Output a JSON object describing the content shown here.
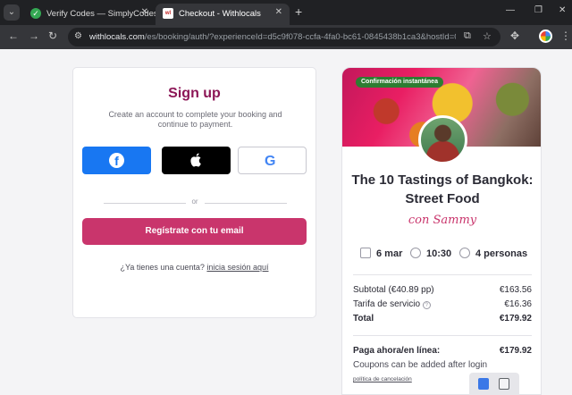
{
  "browser": {
    "tabs": [
      {
        "title": "Verify Codes — SimplyCodes",
        "active": false
      },
      {
        "title": "Checkout - Withlocals",
        "active": true
      }
    ],
    "favicon_text": "wl",
    "url_host": "withlocals.com",
    "url_path": "/es/booking/auth/?experienceId=d5c9f078-ccfa-4fa0-bc61-0845438b1ca3&hostId=038e..."
  },
  "signup": {
    "title": "Sign up",
    "subtitle": "Create an account to complete your booking and continue to payment.",
    "or_label": "or",
    "email_button": "Regístrate con tu email",
    "have_account": "¿Ya tienes una cuenta?",
    "login_link": "inicia sesión aquí"
  },
  "summary": {
    "badge": "Confirmación instantánea",
    "title": "The 10 Tastings of Bangkok: Street Food",
    "host": "con Sammy",
    "date": "6 mar",
    "time": "10:30",
    "people": "4 personas",
    "lines": [
      {
        "label": "Subtotal (€40.89 pp)",
        "value": "€163.56"
      },
      {
        "label": "Tarifa de servicio",
        "value": "€16.36"
      },
      {
        "label": "Total",
        "value": "€179.92"
      }
    ],
    "pay_now_label": "Paga ahora/en línea:",
    "pay_now_value": "€179.92",
    "coupons": "Coupons can be added after login",
    "policy_link": "política de cancelación"
  },
  "colors": {
    "brand": "#8c1656",
    "cta": "#c9356c",
    "facebook": "#1877f2",
    "badge": "#2e7d32"
  }
}
